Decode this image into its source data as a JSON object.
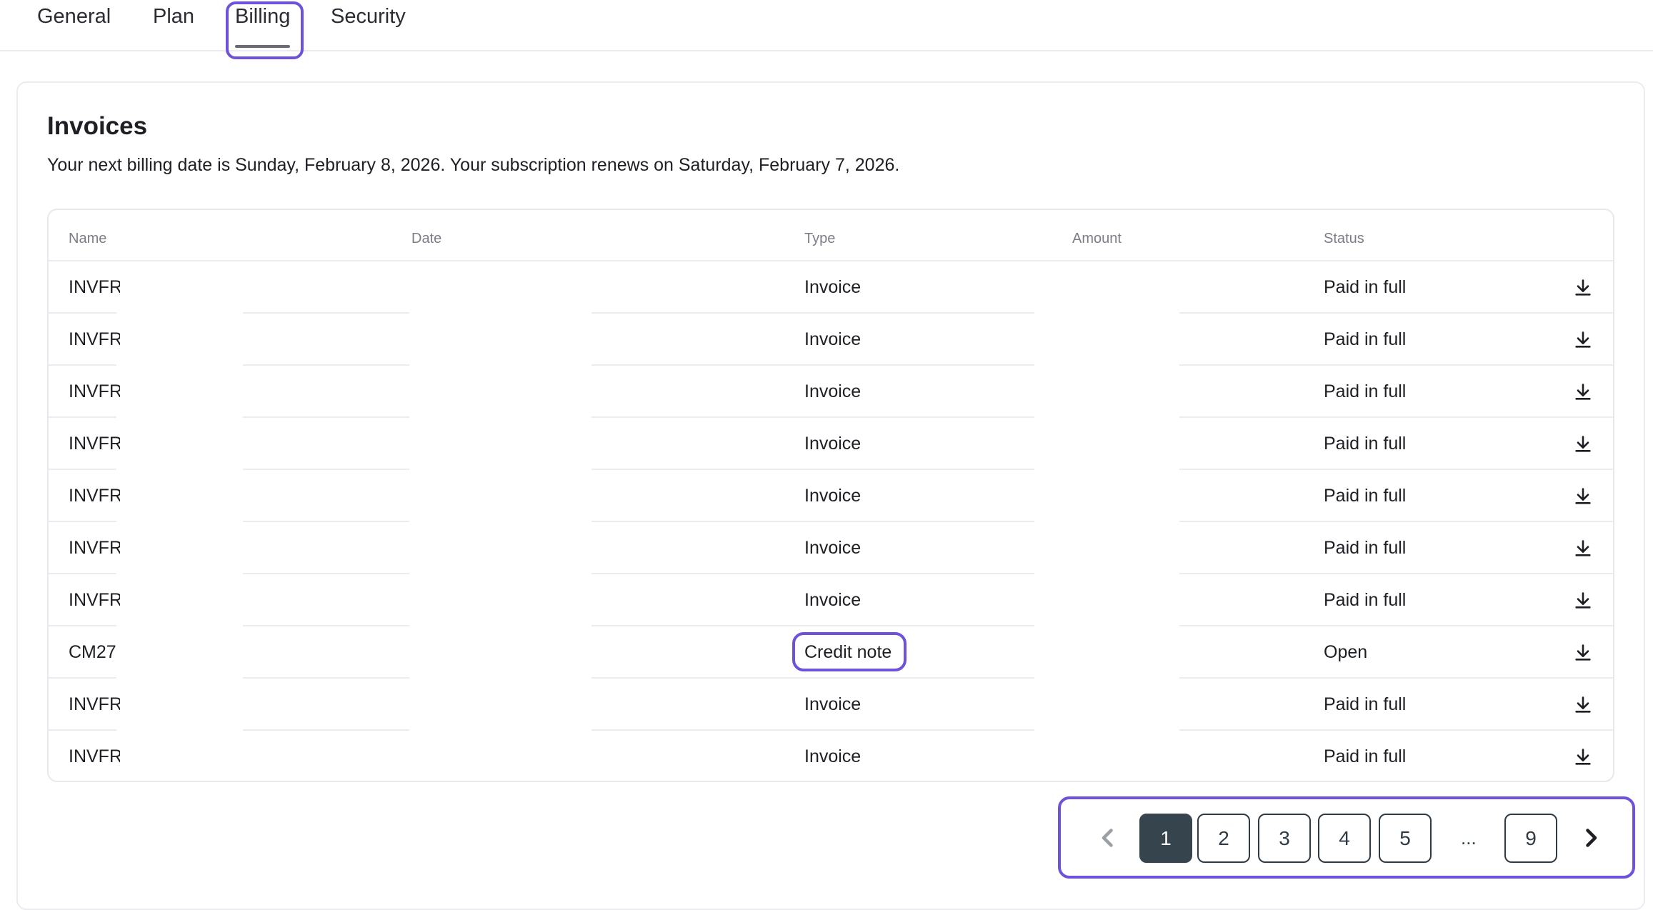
{
  "tabs": [
    {
      "label": "General"
    },
    {
      "label": "Plan"
    },
    {
      "label": "Billing",
      "active": true
    },
    {
      "label": "Security"
    }
  ],
  "invoices": {
    "title": "Invoices",
    "subtitle": "Your next billing date is Sunday, February 8, 2026. Your subscription renews on Saturday, February 7, 2026.",
    "columns": {
      "name": "Name",
      "date": "Date",
      "type": "Type",
      "amount": "Amount",
      "status": "Status"
    },
    "rows": [
      {
        "name": "INVFR",
        "type": "Invoice",
        "status": "Paid in full"
      },
      {
        "name": "INVFR",
        "type": "Invoice",
        "status": "Paid in full"
      },
      {
        "name": "INVFR",
        "type": "Invoice",
        "status": "Paid in full"
      },
      {
        "name": "INVFR",
        "type": "Invoice",
        "status": "Paid in full"
      },
      {
        "name": "INVFR",
        "type": "Invoice",
        "status": "Paid in full"
      },
      {
        "name": "INVFR",
        "type": "Invoice",
        "status": "Paid in full"
      },
      {
        "name": "INVFR",
        "type": "Invoice",
        "status": "Paid in full"
      },
      {
        "name": "CM27",
        "type": "Credit note",
        "status": "Open"
      },
      {
        "name": "INVFR",
        "type": "Invoice",
        "status": "Paid in full"
      },
      {
        "name": "INVFR",
        "type": "Invoice",
        "status": "Paid in full"
      }
    ],
    "row_icon": "download-icon"
  },
  "pagination": {
    "pages": [
      "1",
      "2",
      "3",
      "4",
      "5"
    ],
    "ellipsis": "...",
    "last_page": "9",
    "current_page": "1",
    "prev_icon": "chevron-left-icon",
    "next_icon": "chevron-right-icon"
  },
  "colors": {
    "focus_ring": "#6e52d9",
    "active_page": "#36444d",
    "muted_text": "#7d7d87"
  }
}
